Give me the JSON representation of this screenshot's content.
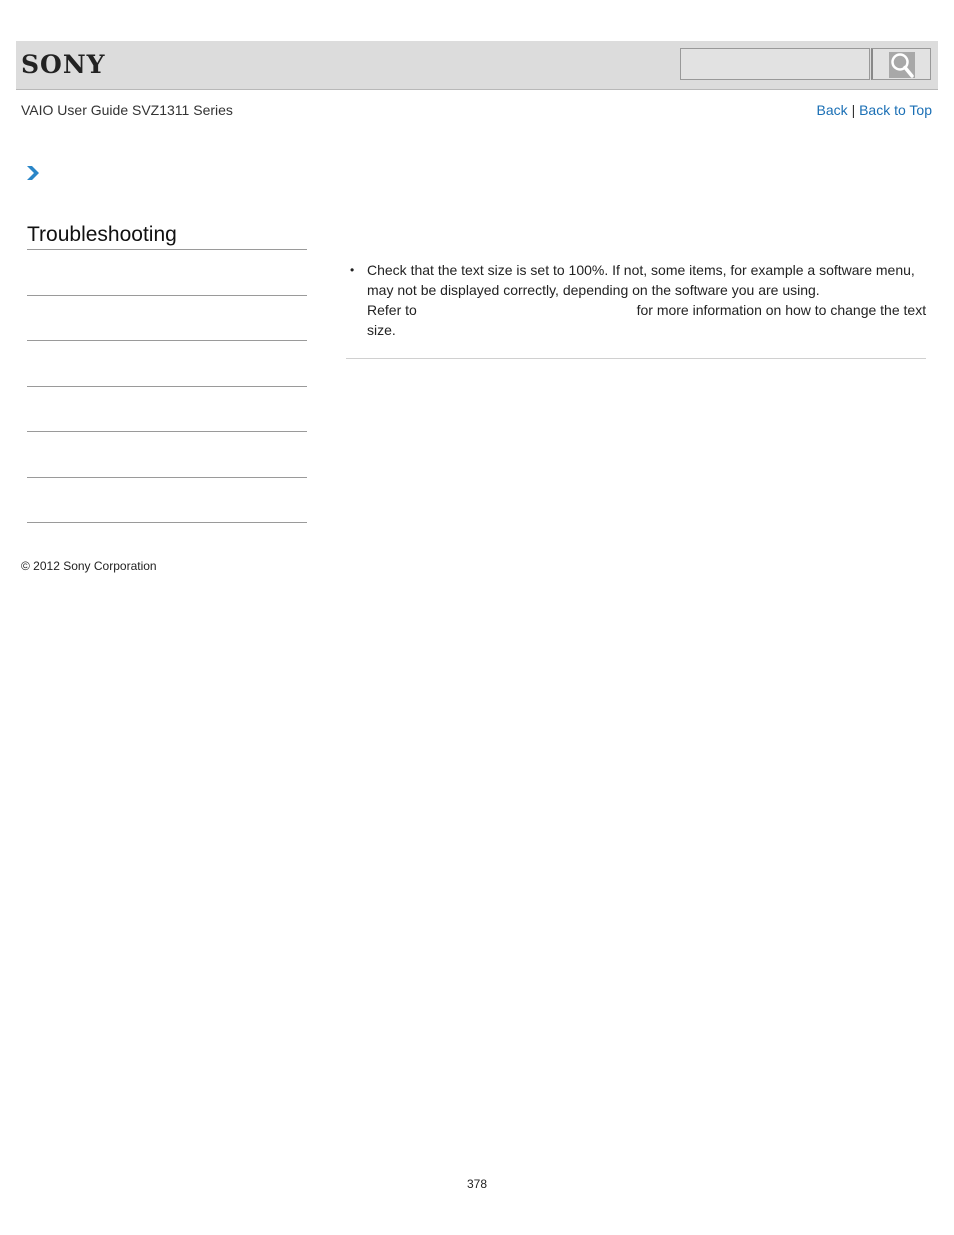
{
  "header": {
    "logo_text": "SONY",
    "search": {
      "placeholder": "",
      "value": ""
    },
    "search_icon": "magnifier-icon"
  },
  "subheader": {
    "guide_title": "VAIO User Guide SVZ1311 Series",
    "back_label": "Back",
    "separator": "|",
    "back_to_top_label": "Back to Top"
  },
  "breadcrumb": {
    "icon": "chevron-right-icon"
  },
  "sidebar": {
    "title": "Troubleshooting",
    "items": [
      {
        "label": ""
      },
      {
        "label": ""
      },
      {
        "label": ""
      },
      {
        "label": ""
      },
      {
        "label": ""
      },
      {
        "label": ""
      }
    ]
  },
  "content": {
    "bullet_text_1": "Check that the text size is set to 100%. If not, some items, for example a software menu, may not be displayed correctly, depending on the software you are using.",
    "refer_prefix": "Refer to",
    "refer_suffix": "for more information on how to change the text size."
  },
  "footer": {
    "copyright": "© 2012 Sony Corporation",
    "page_number": "378"
  }
}
